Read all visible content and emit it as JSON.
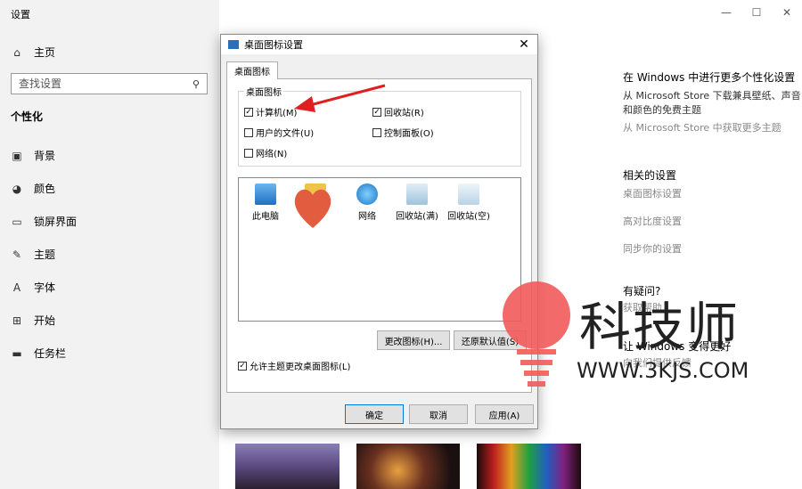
{
  "app": {
    "title": "设置"
  },
  "sidebar": {
    "home": "主页",
    "search_placeholder": "查找设置",
    "section": "个性化",
    "items": [
      {
        "label": "背景",
        "icon": "picture-icon"
      },
      {
        "label": "颜色",
        "icon": "palette-icon"
      },
      {
        "label": "锁屏界面",
        "icon": "lock-screen-icon"
      },
      {
        "label": "主题",
        "icon": "brush-icon"
      },
      {
        "label": "字体",
        "icon": "font-icon"
      },
      {
        "label": "开始",
        "icon": "start-icon"
      },
      {
        "label": "任务栏",
        "icon": "taskbar-icon"
      }
    ]
  },
  "window_controls": {
    "minimize": "—",
    "maximize": "☐",
    "close": "✕"
  },
  "right_panel": {
    "store_heading": "在 Windows 中进行更多个性化设置",
    "store_link": "从 Microsoft Store 下载兼具壁纸、声音和颜色的免费主题",
    "store_more": "从 Microsoft Store 中获取更多主题",
    "related_heading": "相关的设置",
    "related": [
      "桌面图标设置",
      "高对比度设置",
      "同步你的设置"
    ],
    "question_heading": "有疑问?",
    "question_link": "获取帮助",
    "feedback_heading": "让 Windows 变得更好",
    "feedback_link": "向我们提供反馈"
  },
  "dialog": {
    "title": "桌面图标设置",
    "tab": "桌面图标",
    "group_label": "桌面图标",
    "checkboxes": [
      {
        "label": "计算机(M)",
        "checked": "✓"
      },
      {
        "label": "回收站(R)",
        "checked": "✓"
      },
      {
        "label": "用户的文件(U)",
        "checked": ""
      },
      {
        "label": "控制面板(O)",
        "checked": ""
      },
      {
        "label": "网络(N)",
        "checked": ""
      }
    ],
    "icons": [
      "此电脑",
      "",
      "网络",
      "回收站(满)",
      "回收站(空)"
    ],
    "change_icon": "更改图标(H)...",
    "restore_default": "还原默认值(S)",
    "allow_themes": "允许主题更改桌面图标(L)",
    "allow_checked": "✓",
    "ok": "确定",
    "cancel": "取消",
    "apply": "应用(A)"
  },
  "watermark": {
    "brand": "科技师",
    "url": "WWW.3KJS.COM"
  },
  "colors": {
    "accent": "#0078d7",
    "arrow": "#e02020",
    "watermark": "#f15a5a"
  }
}
